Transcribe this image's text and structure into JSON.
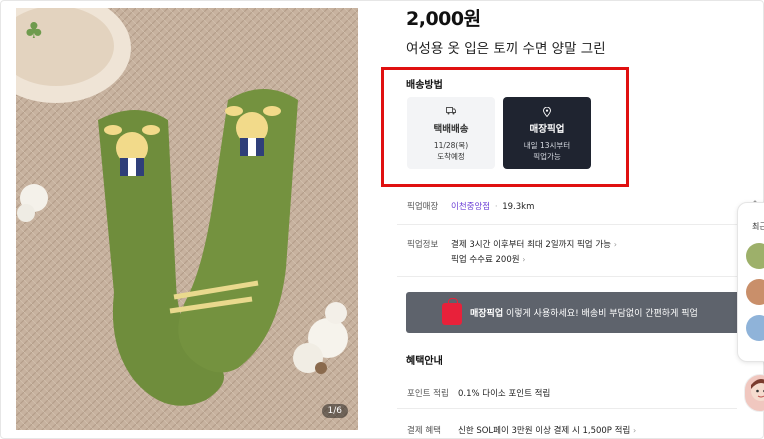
{
  "product": {
    "price": "2,000원",
    "title": "여성용 옷 입은 토끼 수면 양말 그린",
    "image_counter": "1/6"
  },
  "shipping": {
    "label": "배송방법",
    "options": [
      {
        "icon": "truck-icon",
        "name": "택배배송",
        "line1": "11/28(목)",
        "line2": "도착예정"
      },
      {
        "icon": "location-pin-icon",
        "name": "매장픽업",
        "line1": "내일 13시부터",
        "line2": "픽업가능"
      }
    ]
  },
  "pickup_store": {
    "label": "픽업매장",
    "store": "이천중앙점",
    "separator": "·",
    "distance": "19.3km"
  },
  "pickup_info": {
    "label": "픽업정보",
    "line1": "결제 3시간 이후부터 최대 2일까지 픽업 가능",
    "line2": "픽업 수수료 200원"
  },
  "banner": {
    "bold": "매장픽업",
    "text": " 이렇게 사용하세요! 배송비 부담없이 간편하게 픽업"
  },
  "benefits": {
    "title": "혜택안내",
    "rows": [
      {
        "label": "포인트 적립",
        "value": "0.1% 다이소 포인트 적립"
      },
      {
        "label": "결제 혜택",
        "value": "신한 SOL페이 3만원 이상 결제 시 1,500P 적립"
      }
    ]
  },
  "side_panel": {
    "label": "최근"
  },
  "colors": {
    "accent_red": "#e01010",
    "dark_card": "#1f2430",
    "banner_gray": "#5e636c",
    "link_purple": "#6b3fd6"
  }
}
